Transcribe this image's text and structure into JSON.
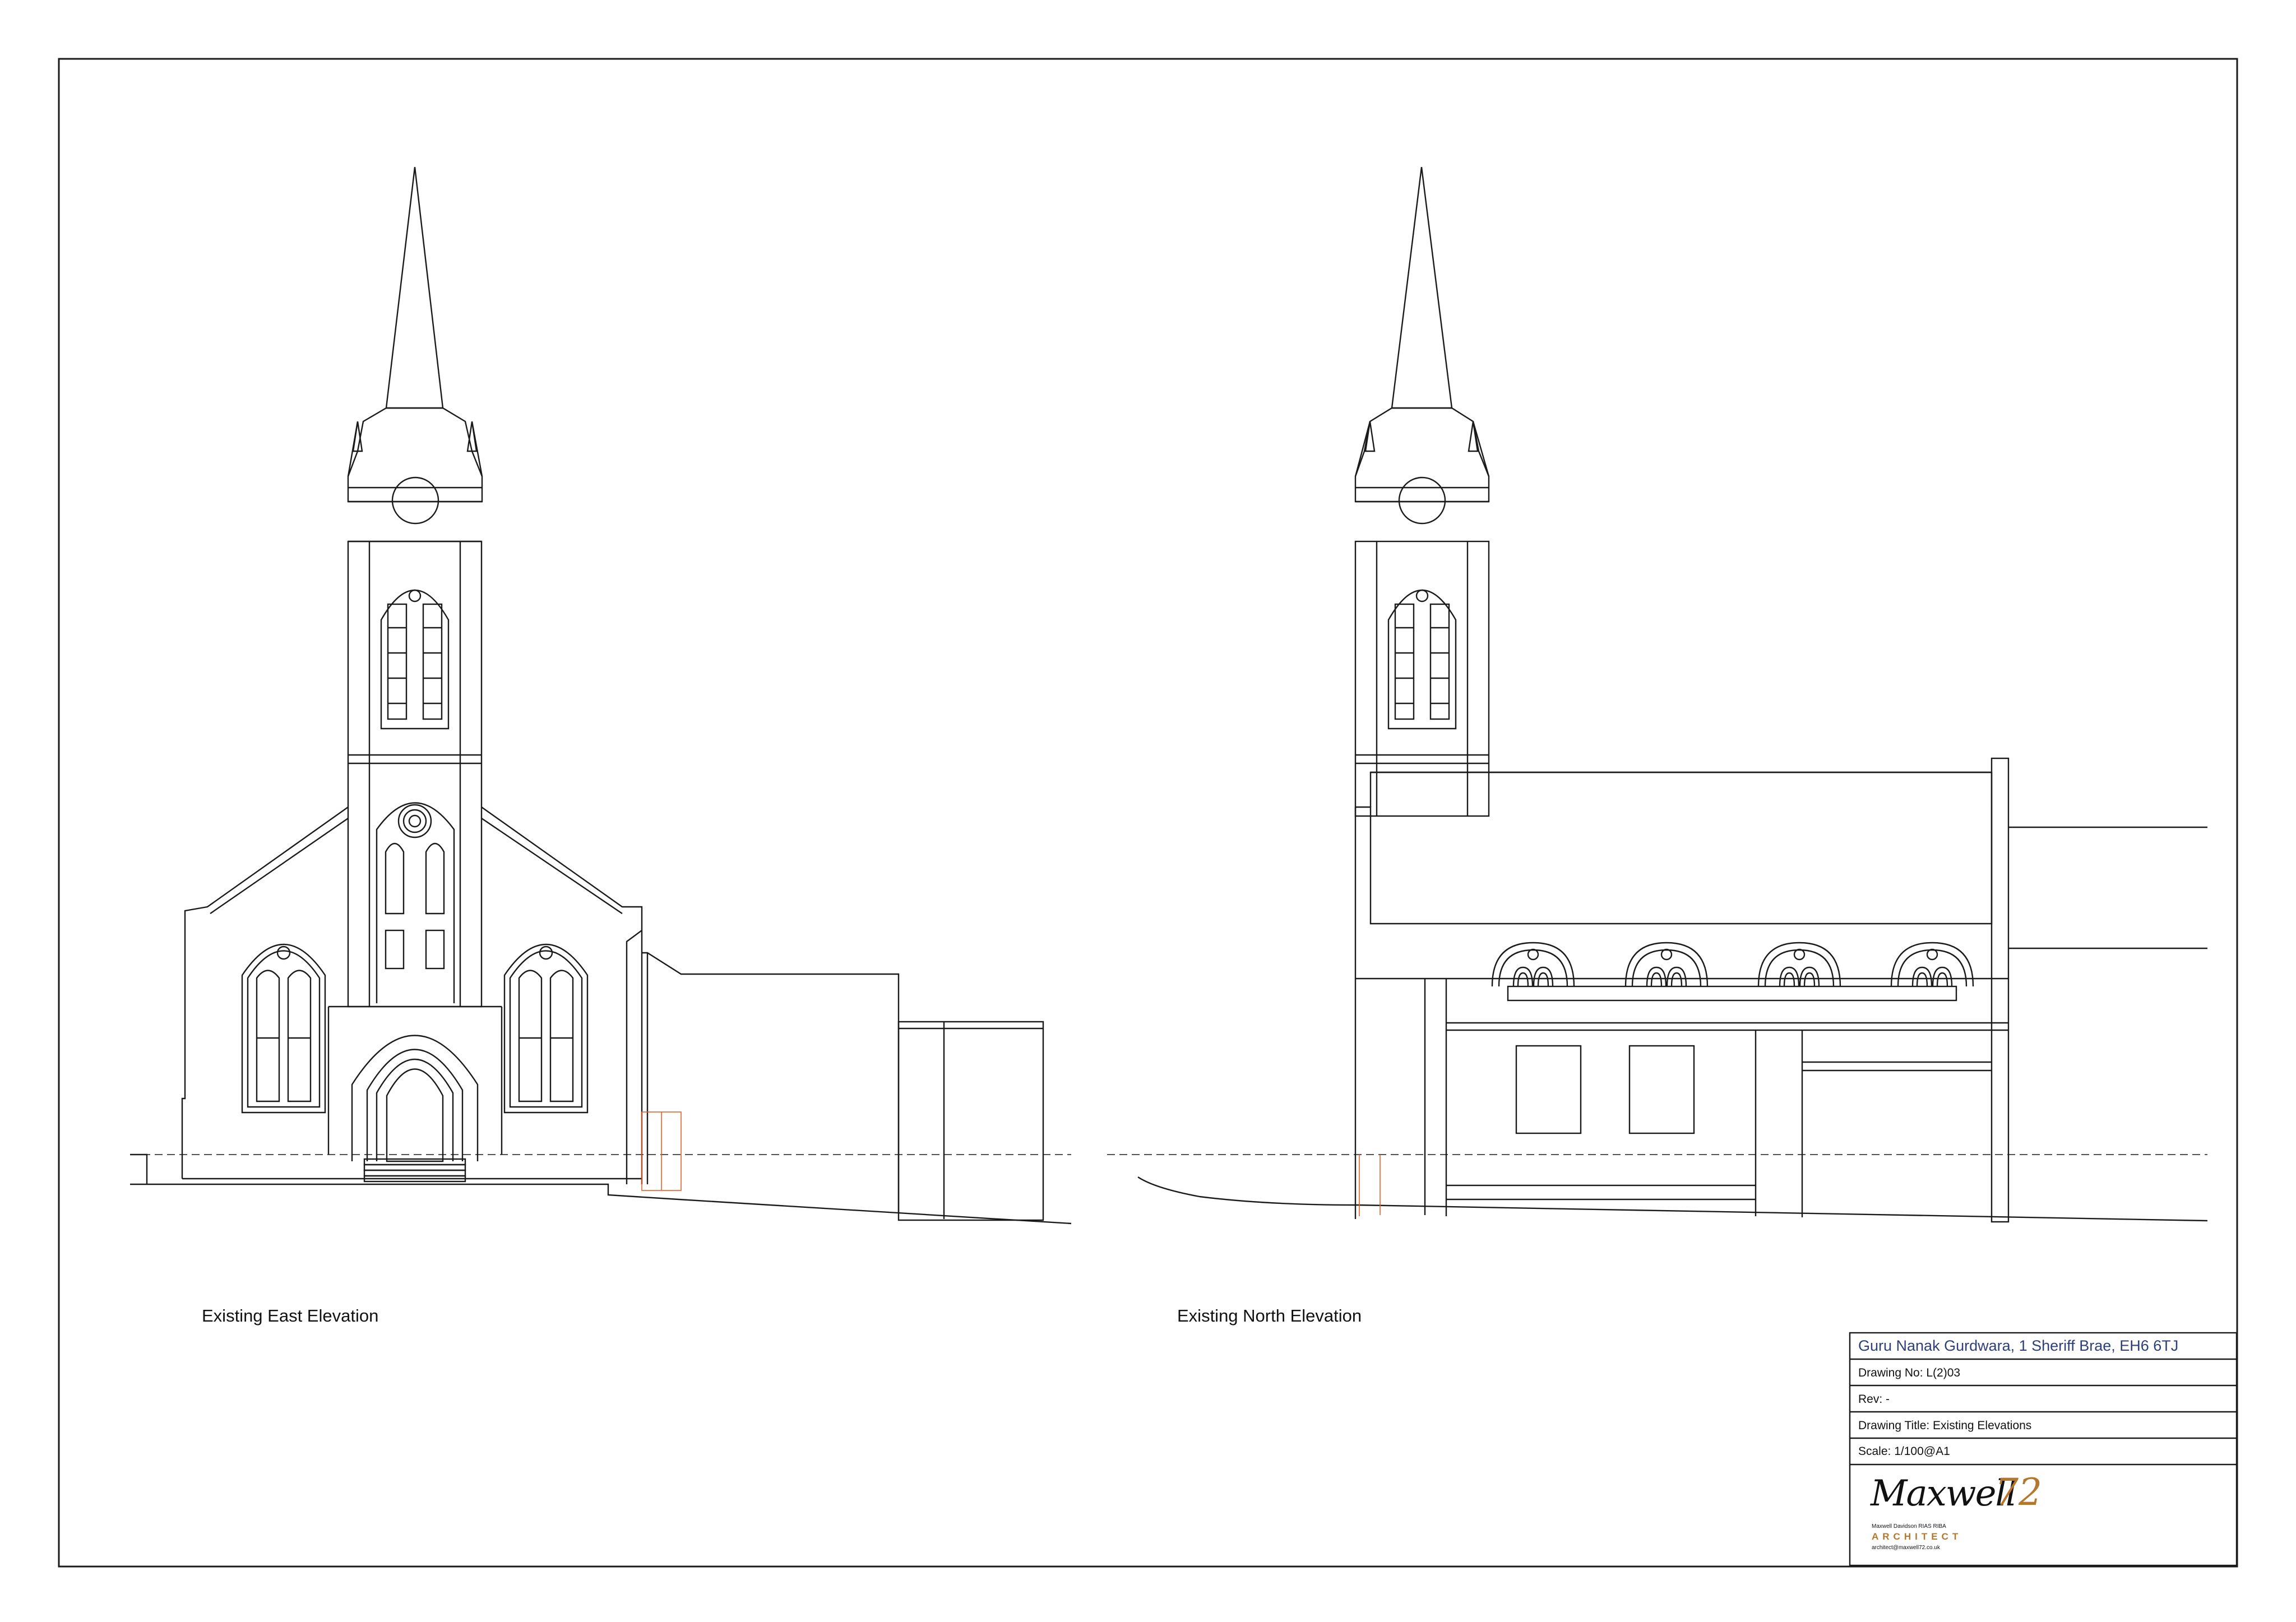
{
  "elevations": {
    "east_caption": "Existing East Elevation",
    "north_caption": "Existing North Elevation"
  },
  "title_block": {
    "project": "Guru Nanak Gurdwara, 1 Sheriff Brae, EH6 6TJ",
    "drawing_no": "Drawing No:   L(2)03",
    "rev": "Rev:  -",
    "drawing_title": "Drawing Title: Existing Elevations",
    "scale": "Scale: 1/100@A1"
  },
  "logo": {
    "wordmark": "Maxwell",
    "number": "72",
    "name_line": "Maxwell Davidson  RIAS RIBA",
    "role": "ARCHITECT",
    "email": "architect@maxwell72.co.uk"
  },
  "colors": {
    "line": "#1a1a1a",
    "red_line": "#e0622a",
    "project_blue": "#2e3f7c",
    "logo_gold": "#b5762d"
  }
}
